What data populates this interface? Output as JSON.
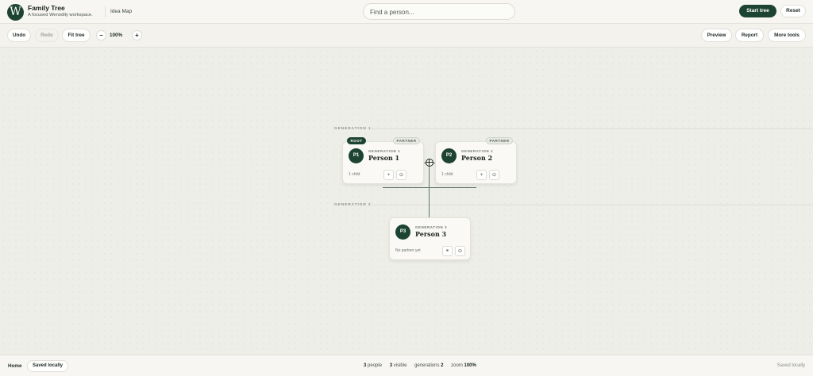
{
  "header": {
    "logo_letter": "W",
    "app_name": "Family Tree",
    "app_subtitle": "A focused Wenodily workspace.",
    "view_name": "Idea Map",
    "search_placeholder": "Find a person...",
    "primary_button": "Start tree",
    "reset_button": "Reset"
  },
  "toolbar": {
    "undo": "Undo",
    "redo": "Redo",
    "fit_tree": "Fit tree",
    "zoom_out": "−",
    "zoom_level": "100%",
    "zoom_in": "+",
    "preview": "Preview",
    "report": "Report",
    "more_tools": "More tools"
  },
  "canvas": {
    "generations": [
      {
        "label": "GENERATION 1"
      },
      {
        "label": "GENERATION 2"
      }
    ],
    "people": [
      {
        "initials": "P1",
        "generation": "GENERATION 1",
        "name": "Person 1",
        "meta": "1 child",
        "badges": [
          "ROOT",
          "PARTNER"
        ]
      },
      {
        "initials": "P2",
        "generation": "GENERATION 1",
        "name": "Person 2",
        "meta": "1 child",
        "badges": [
          "PARTNER"
        ]
      },
      {
        "initials": "P3",
        "generation": "GENERATION 2",
        "name": "Person 3",
        "meta": "No partner yet",
        "badges": []
      }
    ],
    "icons": {
      "add": "+",
      "settings": "⊙",
      "partner": "⚭"
    }
  },
  "footer": {
    "home": "Home",
    "saved_pill": "Saved locally",
    "stats": {
      "people_count": "3",
      "people_label": "people",
      "visible_count": "3",
      "visible_label": "visible",
      "generations_label": "generations",
      "generations_count": "2",
      "zoom_label": "zoom",
      "zoom_value": "100%"
    },
    "saved_status": "Saved locally"
  },
  "colors": {
    "brand": "#1d4433",
    "background": "#eeeee9",
    "connector": "#5f7a6a"
  }
}
